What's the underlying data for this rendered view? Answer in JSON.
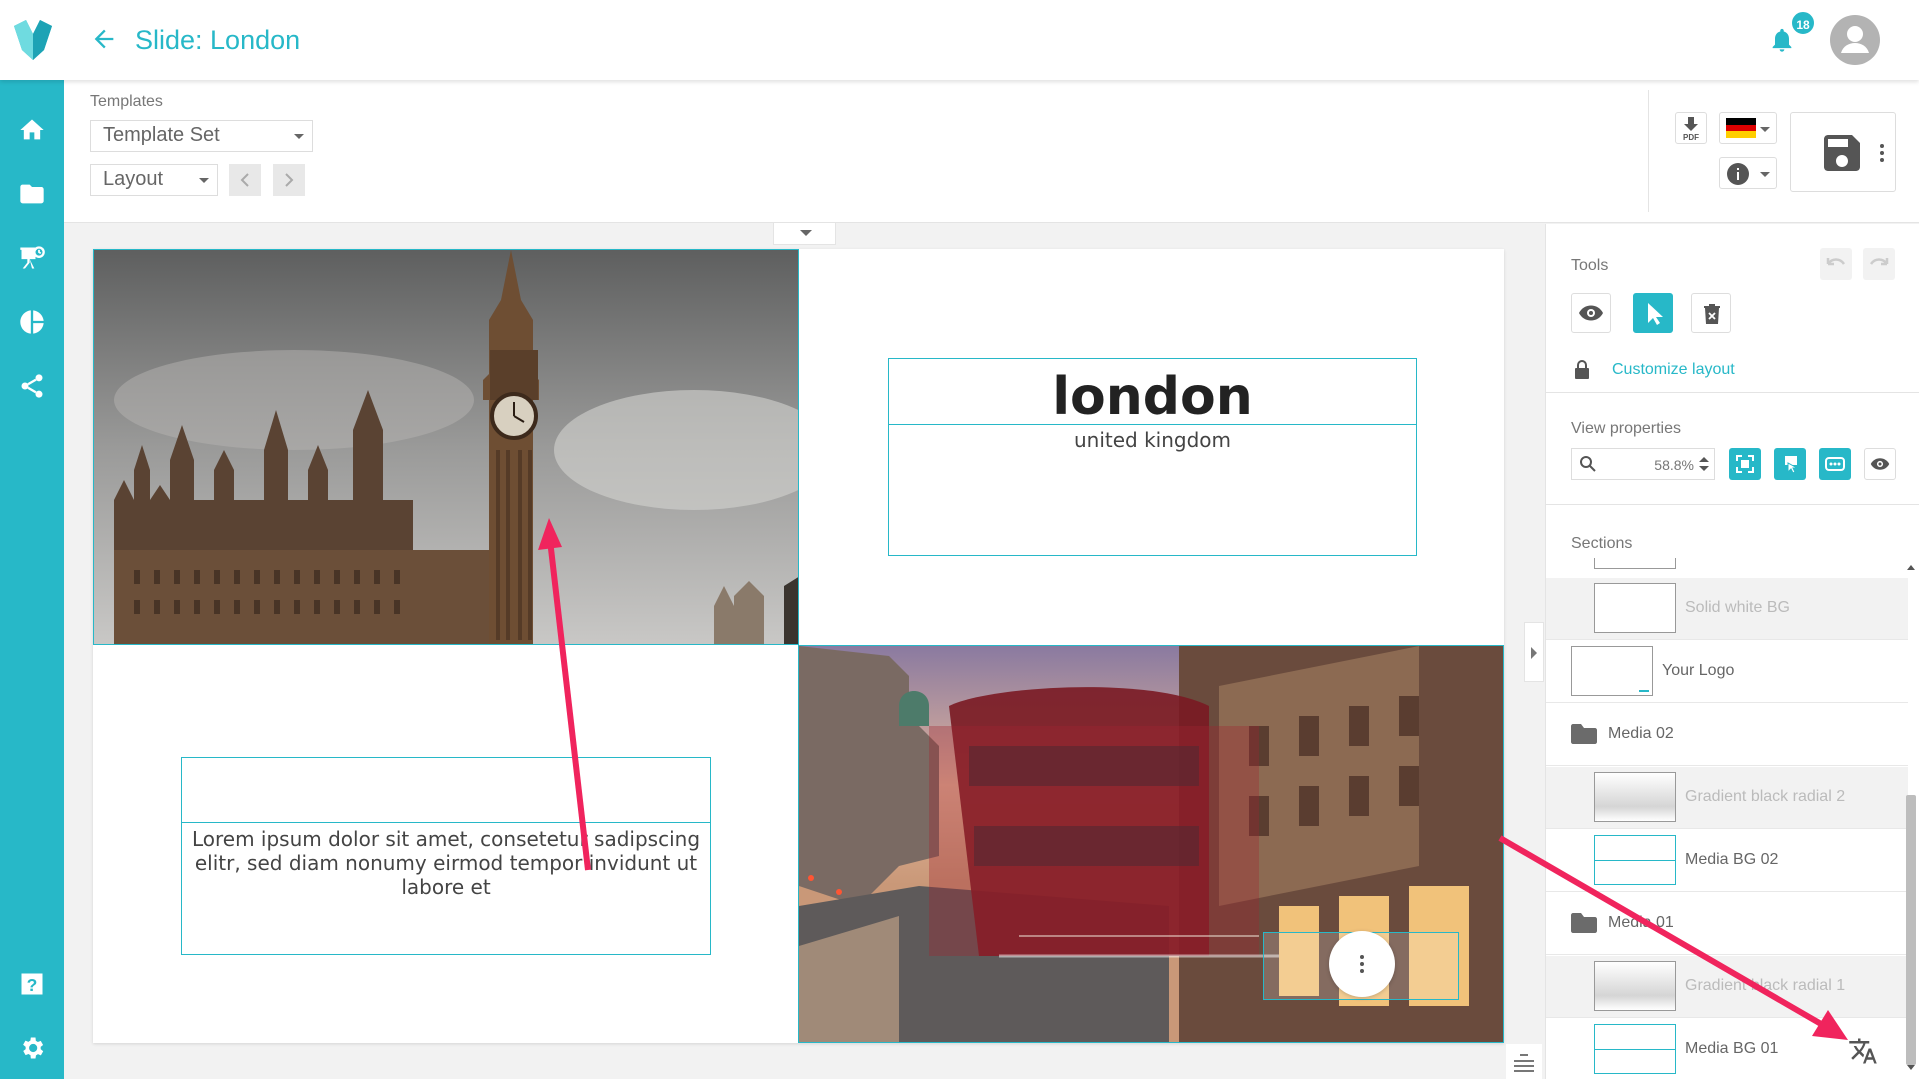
{
  "header": {
    "title": "Slide: London",
    "notification_count": "18"
  },
  "sidebar": {
    "items": [
      "home-icon",
      "folder-icon",
      "presentation-icon",
      "chart-icon",
      "share-icon",
      "help-icon",
      "settings-icon"
    ]
  },
  "toolbar": {
    "templates_label": "Templates",
    "template_set": "Template Set",
    "layout": "Layout",
    "language_flag": "de",
    "pdf_label": "PDF"
  },
  "slide": {
    "heading": "london",
    "subheading": "united kingdom",
    "body_text": "Lorem ipsum dolor sit amet, consetetur sadipscing elitr, sed diam nonumy eirmod tempor invidunt ut labore et"
  },
  "panel": {
    "tools_label": "Tools",
    "customize_label": "Customize layout",
    "view_properties_label": "View properties",
    "zoom_value": "58.8%",
    "sections_label": "Sections",
    "sections": [
      {
        "label": "Solid white BG",
        "kind": "item",
        "dimmed": true
      },
      {
        "label": "Your Logo",
        "kind": "item",
        "dimmed": false
      },
      {
        "label": "Media 02",
        "kind": "folder",
        "dimmed": false
      },
      {
        "label": "Gradient black radial 2",
        "kind": "item",
        "dimmed": true
      },
      {
        "label": "Media BG 02",
        "kind": "item",
        "dimmed": false
      },
      {
        "label": "Media 01",
        "kind": "folder",
        "dimmed": false
      },
      {
        "label": "Gradient black radial 1",
        "kind": "item",
        "dimmed": true
      },
      {
        "label": "Media BG 01",
        "kind": "item",
        "dimmed": false
      }
    ]
  },
  "colors": {
    "accent": "#27b8c8",
    "annotation": "#f0245d"
  }
}
